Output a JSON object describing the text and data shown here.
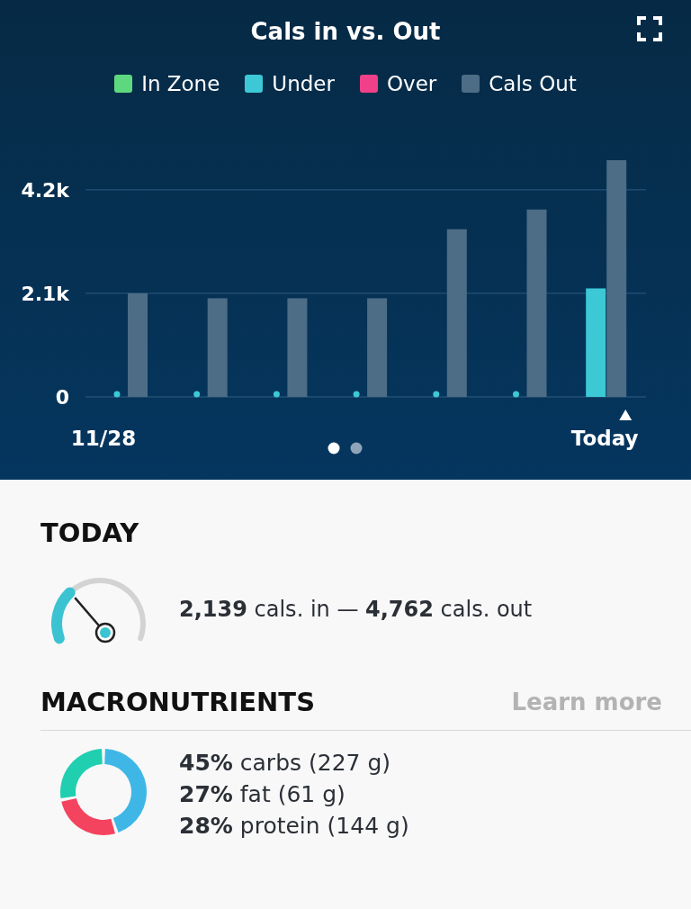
{
  "header": {
    "title": "Cals in vs. Out"
  },
  "chart": {
    "chart_data": {
      "type": "bar",
      "stacked": false,
      "series": [
        {
          "name": "In Zone",
          "color": "#5ed87f",
          "values": [
            null,
            null,
            null,
            null,
            null,
            null,
            null
          ]
        },
        {
          "name": "Under",
          "color": "#3dc8d6",
          "values": [
            0,
            0,
            0,
            0,
            0,
            0,
            2200
          ]
        },
        {
          "name": "Over",
          "color": "#f0408a",
          "values": [
            null,
            null,
            null,
            null,
            null,
            null,
            null
          ]
        },
        {
          "name": "Cals Out",
          "color": "#4d6d86",
          "values": [
            2100,
            2000,
            2000,
            2000,
            3400,
            3800,
            4800
          ]
        }
      ],
      "ylim": [
        0,
        4800
      ],
      "yticks": [
        0,
        {
          "value": 2100,
          "label": "2.1k"
        },
        {
          "value": 4200,
          "label": "4.2k"
        }
      ]
    },
    "axis_labels": {
      "start": "11/28",
      "end": "Today"
    },
    "pages": [
      {
        "selected": true
      },
      {
        "selected": false
      }
    ]
  },
  "today": {
    "heading": "TODAY",
    "summary": "**2,139** cals. in — **4,762** cals. out"
  },
  "macros": {
    "heading": "MACRONUTRIENTS",
    "link": "Learn more",
    "chart_data": {
      "type": "donut",
      "series": [
        {
          "values": [
            45,
            27,
            28
          ],
          "colors": [
            "#3fb7e6",
            "#f4435f",
            "#1fcfb0"
          ]
        }
      ]
    },
    "lines": [
      "**45%** carbs (227 g)",
      "**27%** fat (61 g)",
      "**28%** protein (144 g)"
    ]
  }
}
